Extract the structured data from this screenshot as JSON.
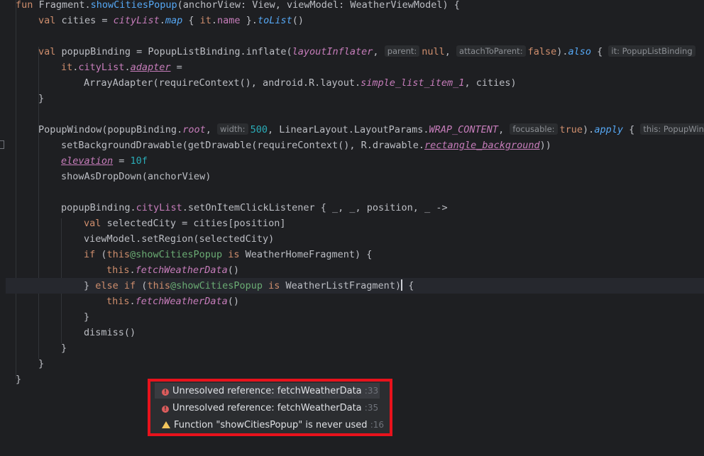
{
  "colors": {
    "background": "#1e1f22",
    "keyword": "#cf8e6d",
    "function": "#56a8f5",
    "property": "#c77dbb",
    "number": "#2aacb8",
    "label": "#6aab73",
    "error": "#db5c5c",
    "warning": "#f2c55c",
    "highlight_box": "#e8121c"
  },
  "code": {
    "l1": {
      "kw": "fun ",
      "recv": "Fragment.",
      "name": "showCitiesPopup",
      "params": "(anchorView: View, viewModel: WeatherViewModel) {"
    },
    "l2": {
      "kw": "val ",
      "var": "cities = ",
      "prop": "cityList",
      "dot": ".",
      "map": "map",
      "open": " { ",
      "it": "it",
      "dot2": ".",
      "name": "name",
      "close": " }.",
      "tolist": "toList",
      "end": "()"
    },
    "l4": {
      "kw": "val ",
      "var": "popupBinding = PopupListBinding.inflate(",
      "arg": "layoutInflater",
      "comma": ", ",
      "hint1": "parent:",
      "null": "null",
      "comma2": ", ",
      "hint2": "attachToParent:",
      "false": "false",
      "close": ").",
      "also": "also",
      "brace": " { ",
      "hint3": "it: PopupListBinding"
    },
    "l5": {
      "it": "it",
      "dot": ".",
      "prop": "cityList",
      "dot2": ".",
      "adapter": "adapter",
      "eq": " ="
    },
    "l6": {
      "pre": "ArrayAdapter(requireContext(), android.R.layout.",
      "res": "simple_list_item_1",
      "post": ", cities)"
    },
    "l7": {
      "text": "}"
    },
    "l9": {
      "pre": "PopupWindow(popupBinding.",
      "root": "root",
      "comma": ", ",
      "hint1": "width:",
      "num": "500",
      "mid": ", LinearLayout.LayoutParams.",
      "wrap": "WRAP_CONTENT",
      "comma2": ", ",
      "hint2": "focusable:",
      "true": "true",
      "close": ").",
      "apply": "apply",
      "brace": " { ",
      "hint3": "this: PopupWindow"
    },
    "l10": {
      "pre": "setBackgroundDrawable(getDrawable(requireContext(), R.drawable.",
      "res": "rectangle_background",
      "post": "))"
    },
    "l11": {
      "prop": "elevation",
      "eq": " = ",
      "num": "10f"
    },
    "l12": {
      "text": "showAsDropDown(anchorView)"
    },
    "l14": {
      "pre": "popupBinding.",
      "prop": "cityList",
      "post": ".setOnItemClickListener { _, _, position, _ ->"
    },
    "l15": {
      "kw": "val ",
      "rest": "selectedCity = cities[position]"
    },
    "l16": {
      "text": "viewModel.setRegion(selectedCity)"
    },
    "l17": {
      "kw": "if ",
      "open": "(",
      "this": "this",
      "label": "@showCitiesPopup",
      "is": " is ",
      "type": "WeatherHomeFragment) {"
    },
    "l18": {
      "this": "this",
      "dot": ".",
      "fn": "fetchWeatherData",
      "end": "()"
    },
    "l19": {
      "close": "} ",
      "else": "else if ",
      "open": "(",
      "this": "this",
      "label": "@showCitiesPopup",
      "is": " is ",
      "type": "WeatherListFragment)",
      "end": " {"
    },
    "l20": {
      "this": "this",
      "dot": ".",
      "fn": "fetchWeatherData",
      "end": "()"
    },
    "l21": {
      "text": "}"
    },
    "l22": {
      "text": "dismiss()"
    },
    "l23": {
      "text": "}"
    },
    "l24": {
      "text": "}"
    },
    "l25": {
      "text": "}"
    }
  },
  "problems": [
    {
      "severity": "error",
      "icon": "error-icon",
      "message": "Unresolved reference: fetchWeatherData",
      "line": ":33"
    },
    {
      "severity": "error",
      "icon": "error-icon",
      "message": "Unresolved reference: fetchWeatherData",
      "line": ":35"
    },
    {
      "severity": "warning",
      "icon": "warning-icon",
      "message": "Function \"showCitiesPopup\" is never used",
      "line": ":16"
    }
  ]
}
